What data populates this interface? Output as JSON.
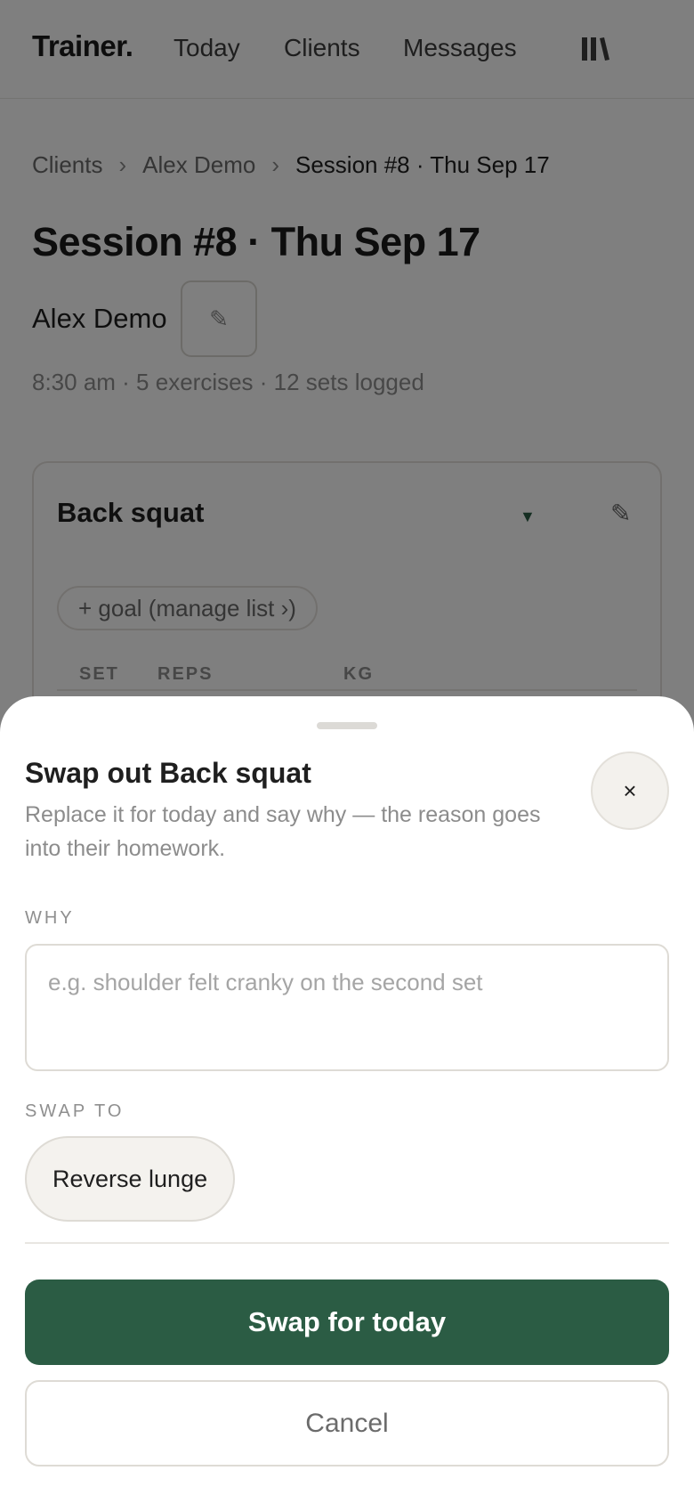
{
  "nav": {
    "brand": "Trainer.",
    "links": [
      "Today",
      "Clients",
      "Messages"
    ],
    "library_icon": "library-icon"
  },
  "breadcrumb": [
    "Clients",
    "Alex Demo",
    "Session #8 · Thu Sep 17"
  ],
  "session": {
    "title": "Session #8 · Thu Sep 17",
    "client": "Alex Demo",
    "meta": "8:30 am · 5 exercises · 12 sets logged"
  },
  "exercise_card": {
    "title": "Back squat",
    "goal_chip": "+ goal (manage list ›)",
    "columns": [
      "SET",
      "REPS",
      "KG"
    ]
  },
  "swap_sheet": {
    "title": "Swap out Back squat",
    "subtitle": "Replace it for today and say why — the reason goes into their homework.",
    "close_glyph": "×",
    "why_label": "WHY",
    "why_placeholder": "e.g. shoulder felt cranky on the second set",
    "why_value": "",
    "swap_to_label": "SWAP TO",
    "options": [
      "Reverse lunge"
    ],
    "primary_label": "Swap for today",
    "secondary_label": "Cancel"
  },
  "colors": {
    "accent": "#2b5c44",
    "scrim": "rgba(0,0,0,0.5)"
  }
}
